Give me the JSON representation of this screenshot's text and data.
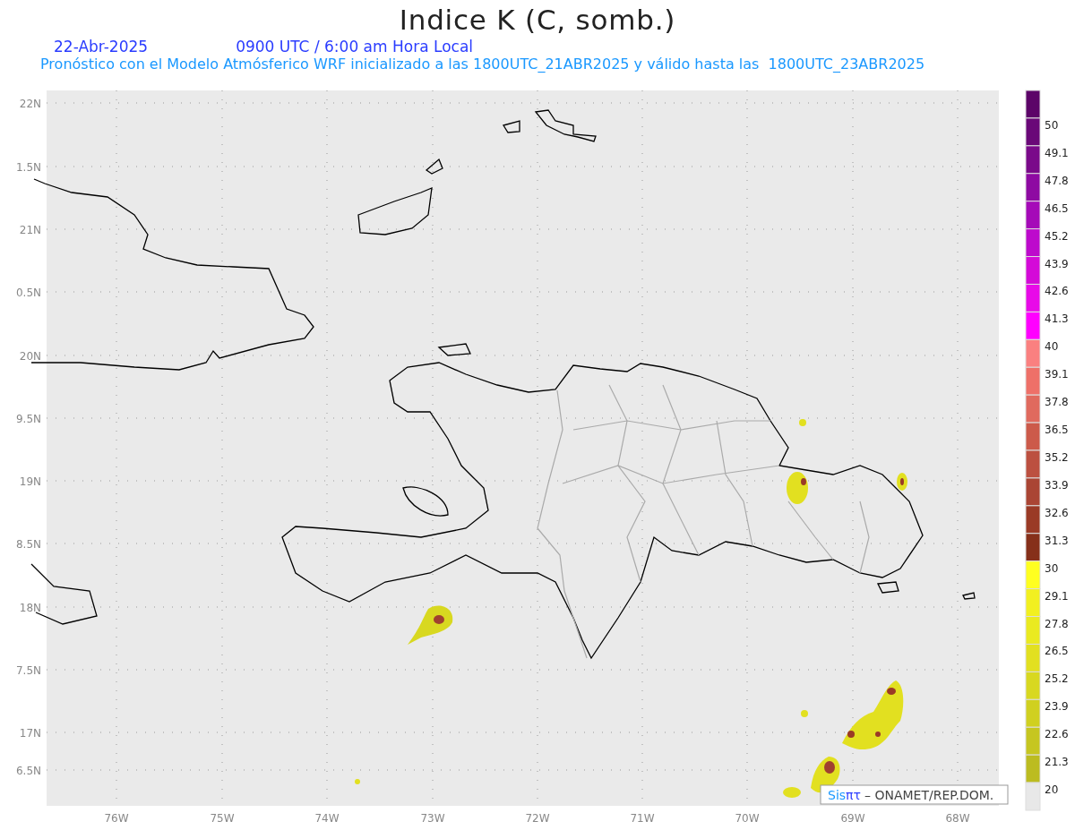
{
  "title": "Indice K (C, somb.)",
  "date": "22-Abr-2025",
  "time": "0900 UTC / 6:00 am Hora Local",
  "subtitle": "Pronóstico con el Modelo Atmósferico WRF inicializado a las 1800UTC_21ABR2025 y válido hasta las  1800UTC_23ABR2025",
  "map": {
    "lat_labels": [
      "22N",
      "1.5N",
      "21N",
      "0.5N",
      "20N",
      "9.5N",
      "19N",
      "8.5N",
      "18N",
      "7.5N",
      "17N",
      "6.5N"
    ],
    "lon_labels": [
      "76W",
      "75W",
      "74W",
      "73W",
      "72W",
      "71W",
      "70W",
      "69W",
      "68W"
    ],
    "credit": {
      "logo_a": "Sis",
      "logo_b": "πτ",
      "text": "– ONAMET/REP.DOM."
    }
  },
  "colorbar": {
    "swatches": [
      {
        "color": "#5c0468"
      },
      {
        "color": "#6a0878"
      },
      {
        "color": "#7a0a8a"
      },
      {
        "color": "#8e0aa2"
      },
      {
        "color": "#a50ab8"
      },
      {
        "color": "#bd0acc"
      },
      {
        "color": "#d40ad8"
      },
      {
        "color": "#e80ae8"
      },
      {
        "color": "#ff00ff"
      },
      {
        "color": "#fa8080"
      },
      {
        "color": "#ee7068"
      },
      {
        "color": "#e06a5e"
      },
      {
        "color": "#cc5a4a"
      },
      {
        "color": "#bc5040"
      },
      {
        "color": "#aa4534"
      },
      {
        "color": "#9a3a26"
      },
      {
        "color": "#86301a"
      },
      {
        "color": "#ffff20"
      },
      {
        "color": "#f2f020"
      },
      {
        "color": "#eaea20"
      },
      {
        "color": "#e2e020"
      },
      {
        "color": "#d8d820"
      },
      {
        "color": "#d0d020"
      },
      {
        "color": "#c6c620"
      },
      {
        "color": "#bcbc20"
      },
      {
        "color": "#e8e8e8"
      }
    ],
    "labels": [
      "50",
      "49.1",
      "47.8",
      "46.5",
      "45.2",
      "43.9",
      "42.6",
      "41.3",
      "40",
      "39.1",
      "37.8",
      "36.5",
      "35.2",
      "33.9",
      "32.6",
      "31.3",
      "30",
      "29.1",
      "27.8",
      "26.5",
      "25.2",
      "23.9",
      "22.6",
      "21.3",
      "20"
    ]
  }
}
